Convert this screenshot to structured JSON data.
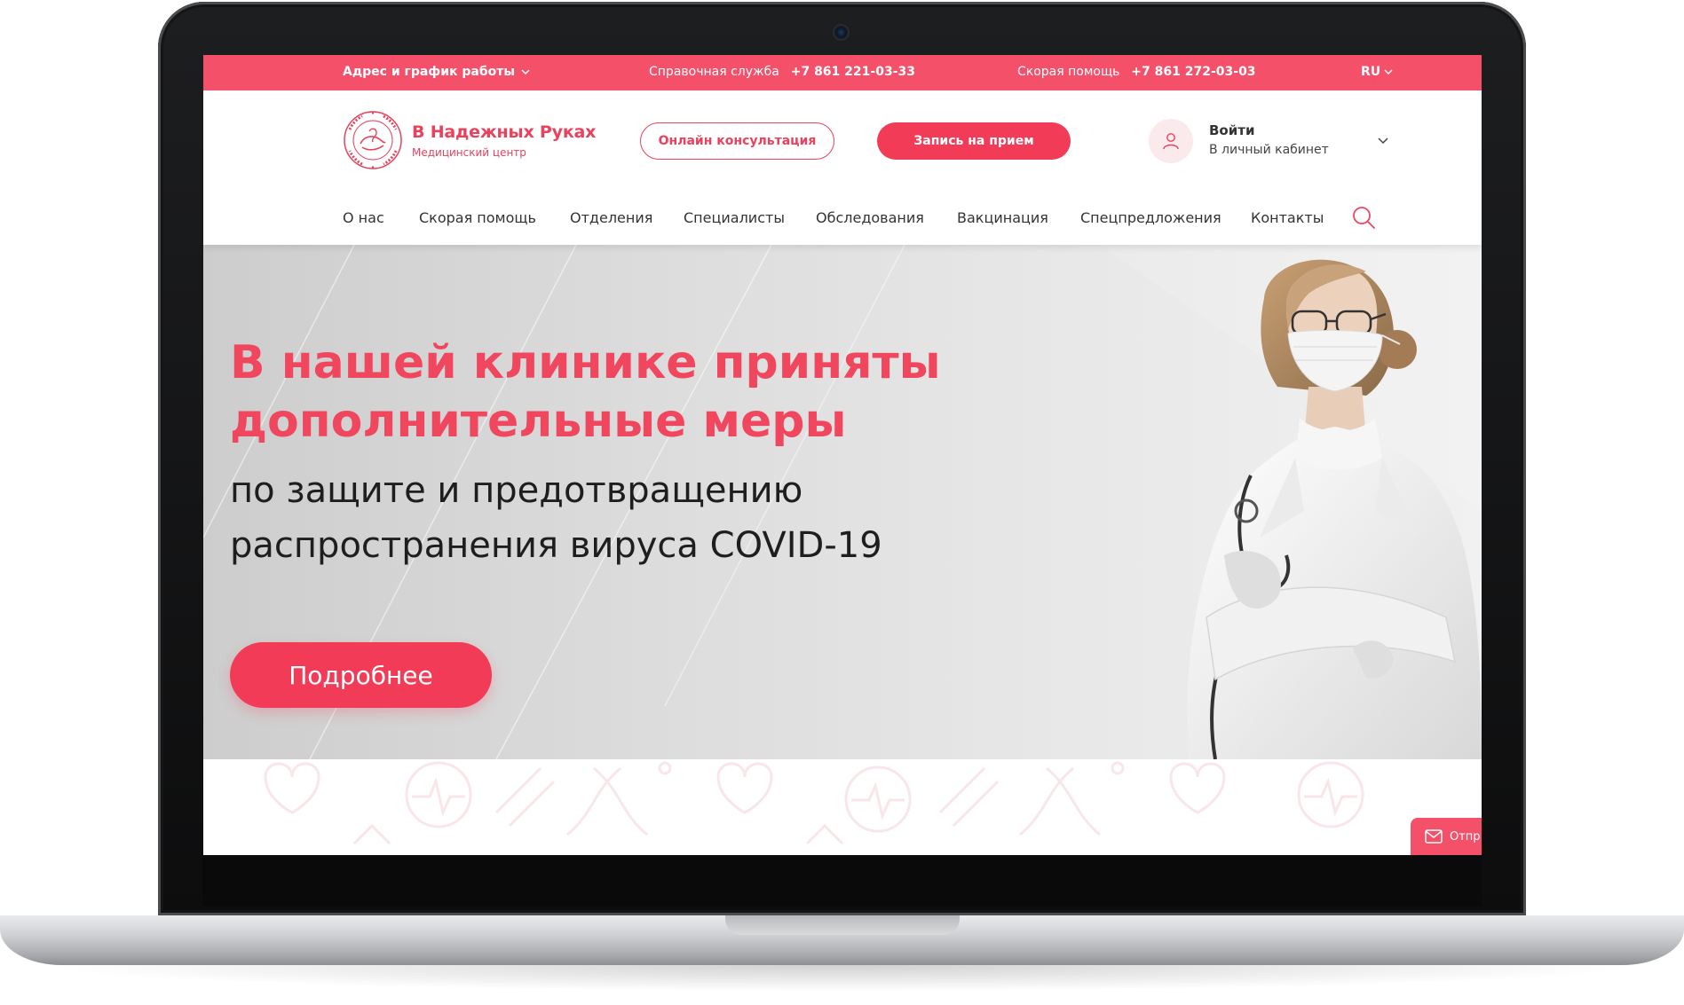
{
  "topbar": {
    "address_label": "Адрес и график работы",
    "ref_label": "Справочная служба",
    "ref_phone": "+7 861 221-03-33",
    "amb_label": "Скорая помощь",
    "amb_phone": "+7 861 272-03-03",
    "lang": "RU"
  },
  "brand": {
    "name": "В Надежных Руках",
    "subtitle": "Медицинский центр",
    "logo_ring_text": "В НАДЕЖНЫХ РУКАХ · МЕДИЦИНСКИЙ ЦЕНТР"
  },
  "header": {
    "consult_label": "Онлайн консультация",
    "appoint_label": "Запись на прием",
    "login_title": "Войти",
    "login_sub": "В личный кабинет"
  },
  "nav": {
    "items": [
      "О нас",
      "Скорая помощь",
      "Отделения",
      "Специалисты",
      "Обследования",
      "Вакцинация",
      "Спецпредложения",
      "Контакты"
    ]
  },
  "hero": {
    "title_line1": "В нашей клинике приняты",
    "title_line2": "дополнительные меры",
    "sub_line1": "по защите и предотвращению",
    "sub_line2": "распространения вируса COVID-19",
    "button_label": "Подробнее"
  },
  "send_tab": {
    "label": "Отпр"
  },
  "colors": {
    "accent": "#f23c57",
    "topbar": "#f5506a",
    "text": "#333333"
  }
}
